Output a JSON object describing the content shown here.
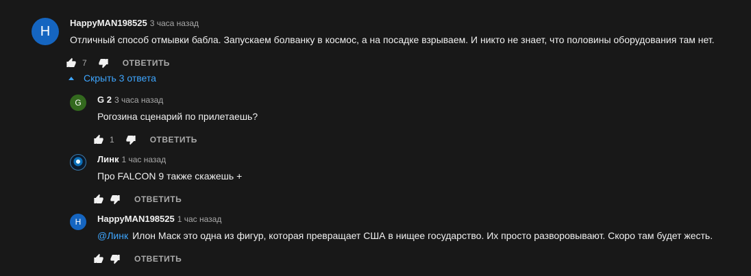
{
  "comments": [
    {
      "author": "HappyMAN198525",
      "time": "3 часа назад",
      "avatar_letter": "H",
      "avatar_color": "#1565c0",
      "text": "Отличный способ отмывки бабла. Запускаем болванку в космос, а на посадке взрываем. И никто не знает, что половины оборудования там нет.",
      "likes": "7",
      "reply_label": "ОТВЕТИТЬ"
    }
  ],
  "replies_toggle": "Скрыть 3 ответа",
  "replies": [
    {
      "author": "G 2",
      "time": "3 часа назад",
      "avatar_letter": "G",
      "avatar_color": "#33691e",
      "text": "Рогозина сценарий по прилетаешь?",
      "likes": "1",
      "reply_label": "ОТВЕТИТЬ"
    },
    {
      "author": "Линк",
      "time": "1 час назад",
      "avatar_letter": "",
      "text": "Про FALCON 9 также скажешь +",
      "likes": "",
      "reply_label": "ОТВЕТИТЬ"
    },
    {
      "author": "HappyMAN198525",
      "time": "1 час назад",
      "avatar_letter": "H",
      "avatar_color": "#1565c0",
      "mention": "@Линк",
      "text": "Илон Маск это одна из фигур, которая превращает США в нищее государство. Их просто разворовывают. Скоро там будет жесть.",
      "likes": "",
      "reply_label": "ОТВЕТИТЬ"
    }
  ]
}
